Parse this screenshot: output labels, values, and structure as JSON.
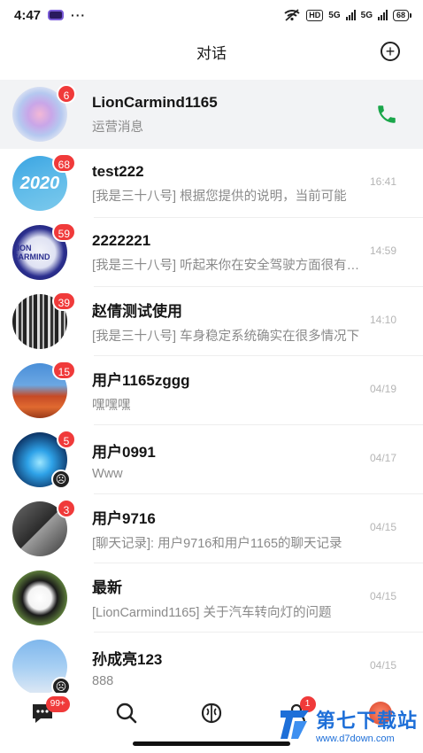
{
  "status_bar": {
    "time": "4:47",
    "dots": "···",
    "hd": "HD",
    "sig1": "5G",
    "sig2": "5G",
    "battery": "68"
  },
  "header": {
    "title": "对话",
    "add_icon": "plus-circle-icon"
  },
  "pinned": {
    "name": "LionCarmind1165",
    "preview": "运营消息",
    "badge": "6",
    "call_icon": "phone-icon",
    "accent": "#1aa64a"
  },
  "conversations": [
    {
      "name": "test222",
      "preview": "[我是三十八号] 根据您提供的说明，当前可能",
      "time": "16:41",
      "badge": "68",
      "avatar_text": "2020",
      "muted": false
    },
    {
      "name": "2222221",
      "preview": "[我是三十八号] 听起来你在安全驾驶方面很有心得",
      "time": "14:59",
      "badge": "59",
      "avatar_text": "LION CARMIND",
      "muted": false
    },
    {
      "name": "赵倩测试使用",
      "preview": "[我是三十八号] 车身稳定系统确实在很多情况下",
      "time": "14:10",
      "badge": "39",
      "avatar_text": "",
      "muted": false
    },
    {
      "name": "用户1165zggg",
      "preview": "嘿嘿嘿",
      "time": "04/19",
      "badge": "15",
      "avatar_text": "",
      "muted": false
    },
    {
      "name": "用户0991",
      "preview": "Www",
      "time": "04/17",
      "badge": "5",
      "avatar_text": "",
      "muted": true
    },
    {
      "name": "用户9716",
      "preview": "[聊天记录]: 用户9716和用户1165的聊天记录",
      "time": "04/15",
      "badge": "3",
      "avatar_text": "",
      "muted": false
    },
    {
      "name": "最新",
      "preview": "[LionCarmind1165] 关于汽车转向灯的问题",
      "time": "04/15",
      "badge": "",
      "avatar_text": "",
      "muted": false
    },
    {
      "name": "孙成亮123",
      "preview": "888",
      "time": "04/15",
      "badge": "",
      "avatar_text": "",
      "muted": true
    }
  ],
  "bottom_nav": {
    "chat_badge": "99+",
    "contacts_badge": "1",
    "icons": [
      "chat-icon",
      "search-icon",
      "discover-icon",
      "contacts-icon",
      "profile-icon"
    ]
  },
  "watermark": {
    "title": "第七下载站",
    "url": "www.d7down.com"
  },
  "colors": {
    "badge": "#f03a3a",
    "pinned_bg": "#f2f3f5",
    "time_text": "#b5b5b5",
    "watermark": "#1e6fd8"
  }
}
